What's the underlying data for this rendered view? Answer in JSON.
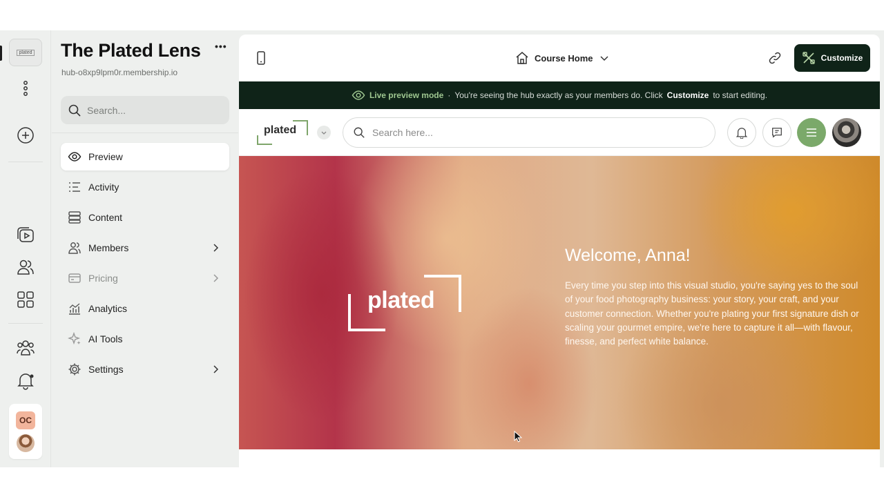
{
  "hub": {
    "title": "The Plated Lens",
    "url": "hub-o8xp9lpm0r.membership.io",
    "more_label": "•••"
  },
  "rail": {
    "logo_label": "plated",
    "org_initials": "OC"
  },
  "sidebar": {
    "search_placeholder": "Search...",
    "items": [
      {
        "label": "Preview"
      },
      {
        "label": "Activity"
      },
      {
        "label": "Content"
      },
      {
        "label": "Members"
      },
      {
        "label": "Pricing"
      },
      {
        "label": "Analytics"
      },
      {
        "label": "AI Tools"
      },
      {
        "label": "Settings"
      }
    ]
  },
  "topbar": {
    "page_select": "Course Home",
    "customize_label": "Customize"
  },
  "banner": {
    "mode": "Live preview mode",
    "separator": "·",
    "text_before": "You're seeing the hub exactly as your members do. Click",
    "emphasis": "Customize",
    "text_after": "to start editing."
  },
  "hub_header": {
    "brand": "plated",
    "search_placeholder": "Search here..."
  },
  "hero": {
    "logo_word": "plated",
    "title": "Welcome, Anna!",
    "body": "Every time you step into this visual studio, you're saying yes to the soul of your food photography business: your story, your craft, and your customer connection. Whether you're plating your first signature dish or scaling your gourmet empire, we're here to capture it all—with flavour, finesse, and perfect white balance."
  },
  "colors": {
    "dark": "#0f2318",
    "accent_green": "#7ba96a",
    "live_green": "#9ec690",
    "org_badge": "#f2b59c"
  }
}
